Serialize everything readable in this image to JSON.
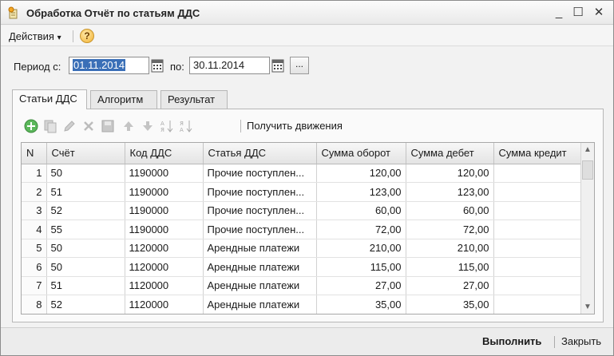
{
  "window": {
    "title": "Обработка  Отчёт по статьям ДДС",
    "minimize": "_",
    "maximize": "☐",
    "close": "✕"
  },
  "menu": {
    "actions_label": "Действия",
    "actions_arrow": "▾",
    "help_glyph": "?"
  },
  "period": {
    "from_label": "Период с:",
    "from_value": "01.11.2014",
    "to_label": "по:",
    "to_value": "30.11.2014",
    "ellipsis": "..."
  },
  "tabs": [
    {
      "label": "Статьи ДДС",
      "active": true
    },
    {
      "label": "Алгоритм",
      "active": false
    },
    {
      "label": "Результат",
      "active": false
    }
  ],
  "toolbar": {
    "icons": [
      "add-icon",
      "copy-icon",
      "edit-icon",
      "delete-icon",
      "save-icon",
      "move-up-icon",
      "move-down-icon",
      "sort-asc-icon",
      "sort-desc-icon"
    ],
    "get_movements_label": "Получить движения"
  },
  "table": {
    "columns": [
      "N",
      "Счёт",
      "Код ДДС",
      "Статья ДДС",
      "Сумма оборот",
      "Сумма дебет",
      "Сумма кредит"
    ],
    "rows": [
      {
        "n": "1",
        "account": "50",
        "code": "1190000",
        "article": "Прочие поступлен...",
        "turnover": "120,00",
        "debit": "120,00",
        "credit": ""
      },
      {
        "n": "2",
        "account": "51",
        "code": "1190000",
        "article": "Прочие поступлен...",
        "turnover": "123,00",
        "debit": "123,00",
        "credit": ""
      },
      {
        "n": "3",
        "account": "52",
        "code": "1190000",
        "article": "Прочие поступлен...",
        "turnover": "60,00",
        "debit": "60,00",
        "credit": ""
      },
      {
        "n": "4",
        "account": "55",
        "code": "1190000",
        "article": "Прочие поступлен...",
        "turnover": "72,00",
        "debit": "72,00",
        "credit": ""
      },
      {
        "n": "5",
        "account": "50",
        "code": "1120000",
        "article": "Арендные платежи",
        "turnover": "210,00",
        "debit": "210,00",
        "credit": ""
      },
      {
        "n": "6",
        "account": "50",
        "code": "1120000",
        "article": "Арендные платежи",
        "turnover": "115,00",
        "debit": "115,00",
        "credit": ""
      },
      {
        "n": "7",
        "account": "51",
        "code": "1120000",
        "article": "Арендные платежи",
        "turnover": "27,00",
        "debit": "27,00",
        "credit": ""
      },
      {
        "n": "8",
        "account": "52",
        "code": "1120000",
        "article": "Арендные платежи",
        "turnover": "35,00",
        "debit": "35,00",
        "credit": ""
      }
    ]
  },
  "footer": {
    "run_label": "Выполнить",
    "close_label": "Закрыть"
  },
  "colors": {
    "selection": "#3a6fb7",
    "add_icon": "#4caf50",
    "help_icon": "#f2b233"
  }
}
